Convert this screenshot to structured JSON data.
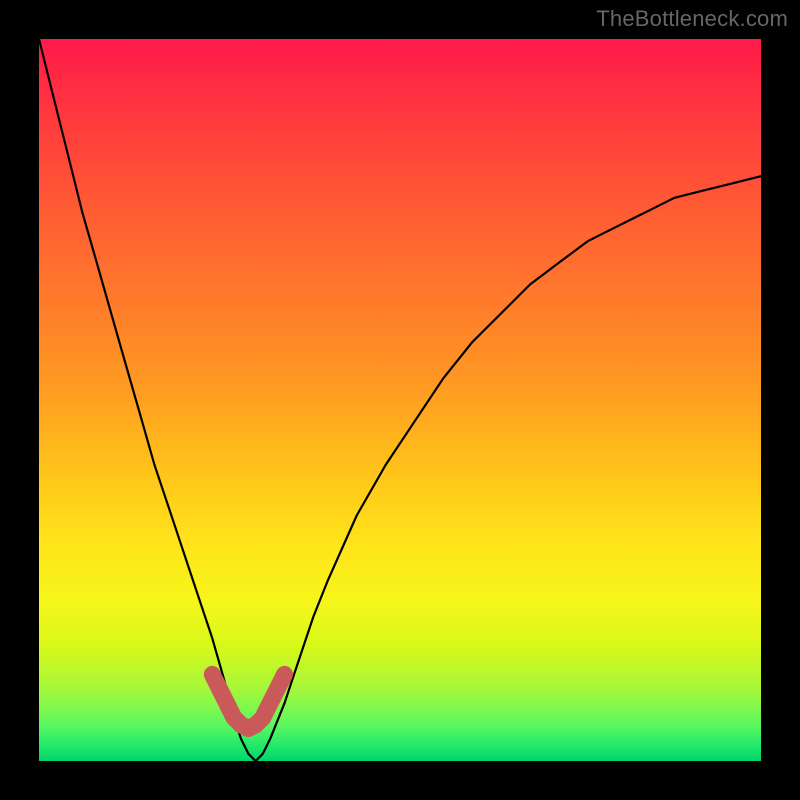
{
  "watermark": "TheBottleneck.com",
  "chart_data": {
    "type": "line",
    "title": "",
    "xlabel": "",
    "ylabel": "",
    "xlim": [
      0,
      100
    ],
    "ylim": [
      0,
      100
    ],
    "grid": false,
    "series": [
      {
        "name": "curve",
        "x": [
          0,
          2,
          4,
          6,
          8,
          10,
          12,
          14,
          16,
          18,
          20,
          22,
          24,
          26,
          27,
          28,
          29,
          30,
          31,
          32,
          34,
          36,
          38,
          40,
          44,
          48,
          52,
          56,
          60,
          64,
          68,
          72,
          76,
          80,
          84,
          88,
          92,
          96,
          100
        ],
        "y": [
          100,
          92,
          84,
          76,
          69,
          62,
          55,
          48,
          41,
          35,
          29,
          23,
          17,
          10,
          6,
          3,
          1,
          0,
          1,
          3,
          8,
          14,
          20,
          25,
          34,
          41,
          47,
          53,
          58,
          62,
          66,
          69,
          72,
          74,
          76,
          78,
          79,
          80,
          81
        ]
      }
    ],
    "highlight": {
      "name": "red-segment",
      "x": [
        24,
        25,
        26,
        27,
        28,
        29,
        30,
        31,
        32,
        33,
        34
      ],
      "y": [
        12,
        10,
        8,
        6,
        5,
        4.5,
        5,
        6,
        8,
        10,
        12
      ],
      "color": "#ca5a5a"
    }
  }
}
